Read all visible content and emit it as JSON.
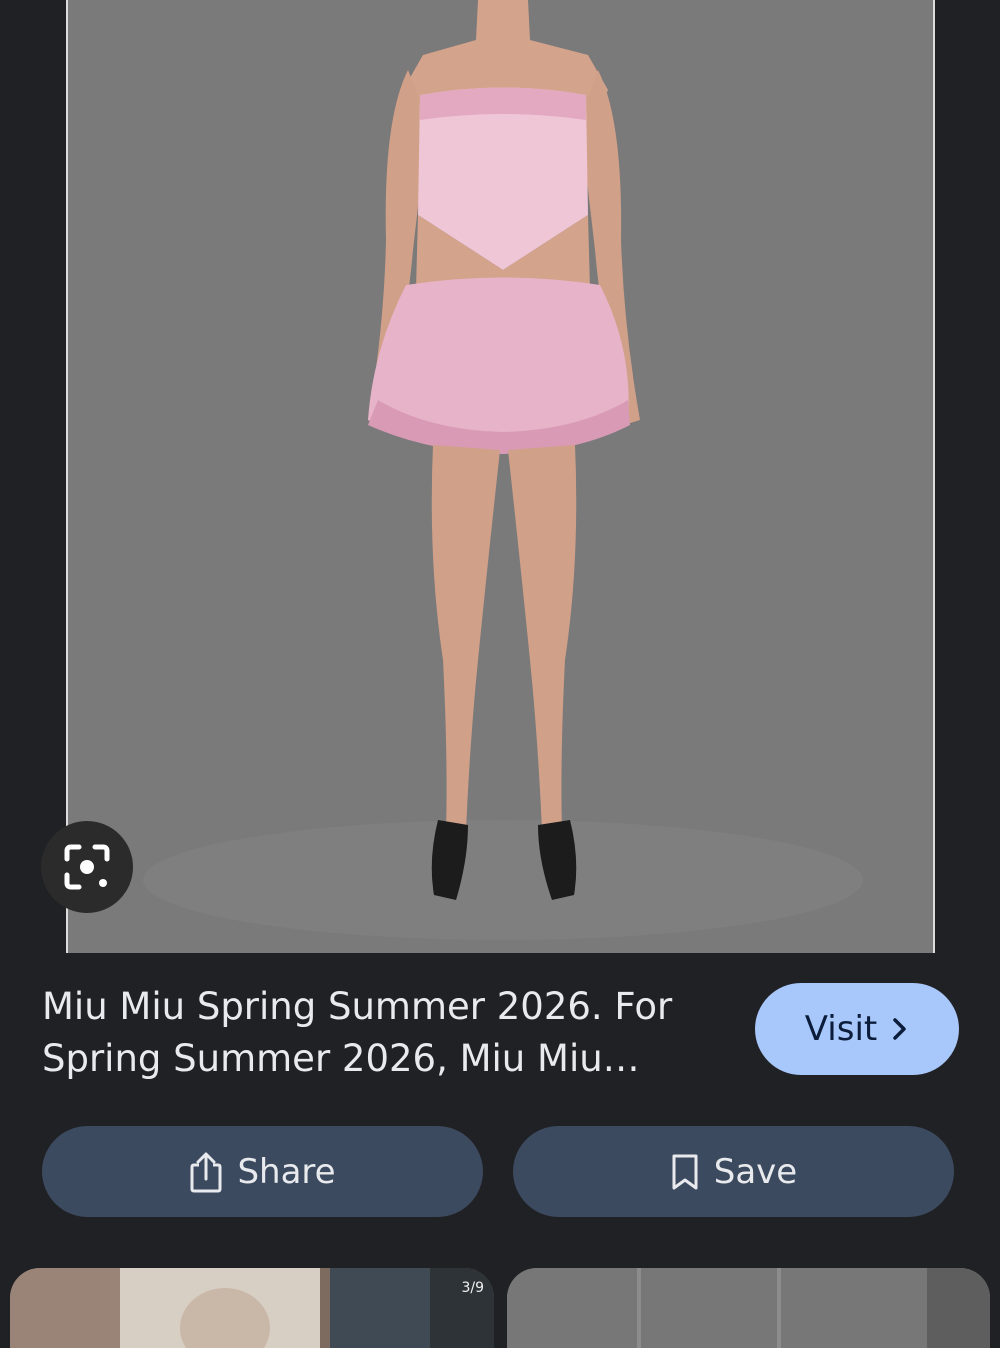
{
  "caption": {
    "title": "Miu Miu Spring Summer 2026. For Spring Summer 2026, Miu Miu…",
    "visit_label": "Visit"
  },
  "actions": {
    "share_label": "Share",
    "save_label": "Save"
  },
  "related": {
    "first_counter": "3/9"
  },
  "icons": {
    "lens": "google-lens-icon",
    "share": "share-icon",
    "save": "bookmark-icon",
    "visit": "chevron-right-icon"
  },
  "colors": {
    "background": "#202124",
    "visit_button": "#a8c7fa",
    "action_button": "#3c4a5f",
    "text": "#e8eaed"
  }
}
